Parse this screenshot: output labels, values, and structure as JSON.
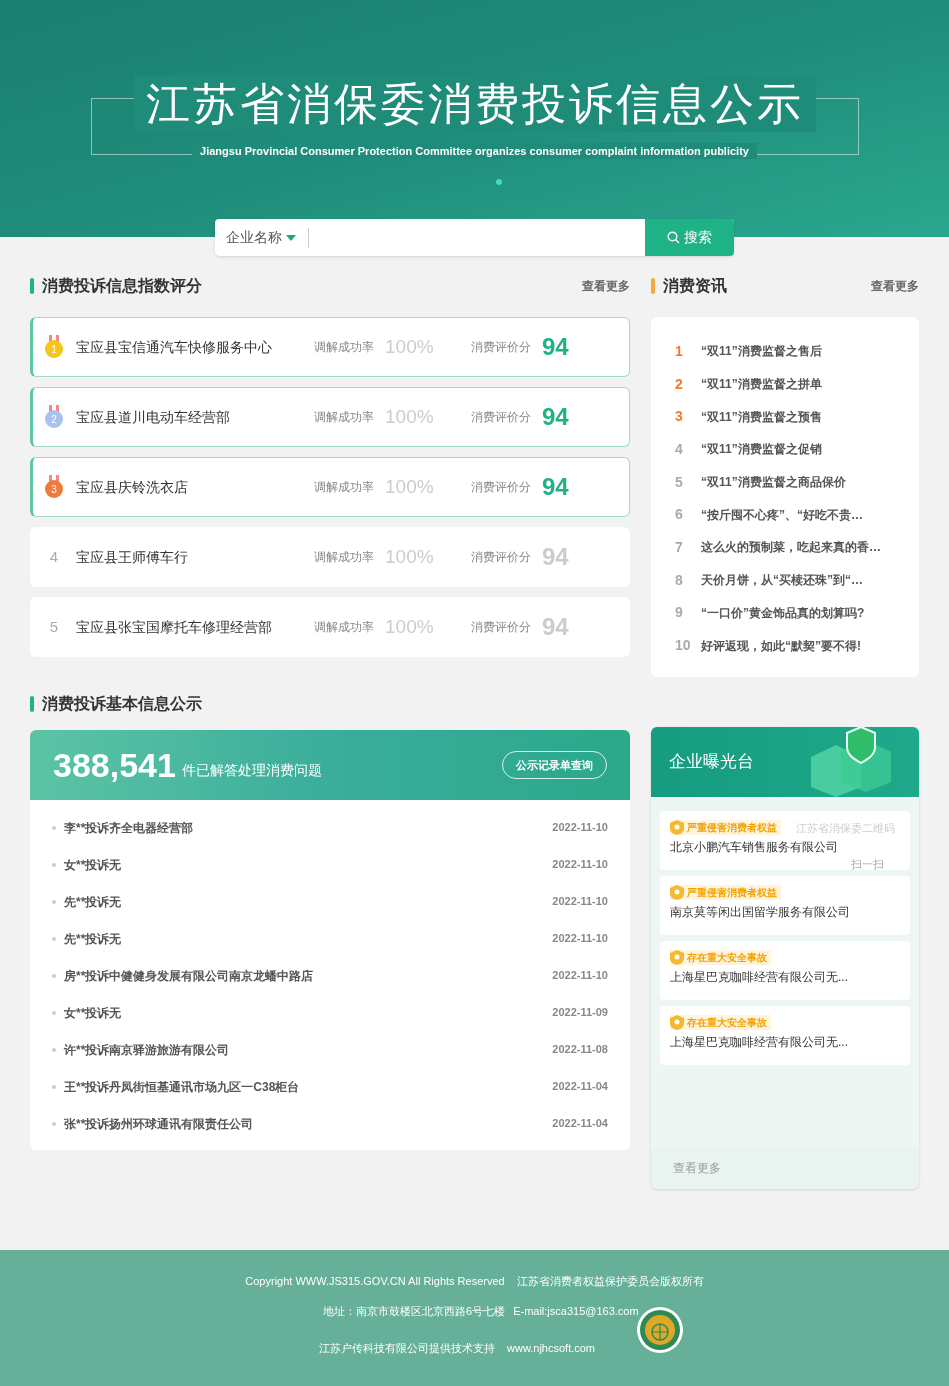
{
  "banner": {
    "title": "江苏省消保委消费投诉信息公示",
    "subtitle": "Jiangsu Provincial Consumer Protection Committee organizes consumer complaint information publicity"
  },
  "search": {
    "category": "企业名称",
    "button": "搜索"
  },
  "ranking": {
    "title": "消费投诉信息指数评分",
    "more": "查看更多",
    "rows": [
      {
        "rank": "1",
        "highlighted": true,
        "color": "#f5c518",
        "name": "宝应县宝信通汽车快修服务中心",
        "rate_label": "调解成功率",
        "rate": "100%",
        "score_label": "消费评价分",
        "score": "94"
      },
      {
        "rank": "2",
        "highlighted": true,
        "color": "#a9c1ee",
        "name": "宝应县道川电动车经营部",
        "rate_label": "调解成功率",
        "rate": "100%",
        "score_label": "消费评价分",
        "score": "94"
      },
      {
        "rank": "3",
        "highlighted": true,
        "color": "#ee7a3c",
        "name": "宝应县庆铃洗衣店",
        "rate_label": "调解成功率",
        "rate": "100%",
        "score_label": "消费评价分",
        "score": "94"
      },
      {
        "rank": "4",
        "highlighted": false,
        "name": "宝应县王师傅车行",
        "rate_label": "调解成功率",
        "rate": "100%",
        "score_label": "消费评价分",
        "score": "94"
      },
      {
        "rank": "5",
        "highlighted": false,
        "name": "宝应县张宝国摩托车修理经营部",
        "rate_label": "调解成功率",
        "rate": "100%",
        "score_label": "消费评价分",
        "score": "94"
      }
    ]
  },
  "news": {
    "title": "消费资讯",
    "more": "查看更多",
    "items": [
      {
        "number": "1",
        "highlighted": true,
        "title": "“双11”消费监督之售后"
      },
      {
        "number": "2",
        "highlighted": true,
        "title": "“双11”消费监督之拼单"
      },
      {
        "number": "3",
        "highlighted": true,
        "title": "“双11”消费监督之预售"
      },
      {
        "number": "4",
        "highlighted": false,
        "title": "“双11”消费监督之促销"
      },
      {
        "number": "5",
        "highlighted": false,
        "title": "“双11”消费监督之商品保价"
      },
      {
        "number": "6",
        "highlighted": false,
        "title": "“按斤囤不心疼”、“好吃不贵…"
      },
      {
        "number": "7",
        "highlighted": false,
        "title": "这么火的预制菜，吃起来真的香…"
      },
      {
        "number": "8",
        "highlighted": false,
        "title": "天价月饼，从“买椟还珠”到“…"
      },
      {
        "number": "9",
        "highlighted": false,
        "title": "“一口价”黄金饰品真的划算吗?"
      },
      {
        "number": "10",
        "highlighted": false,
        "title": "好评返现，如此“默契”要不得!"
      }
    ]
  },
  "complaints": {
    "title": "消费投诉基本信息公示",
    "count": "388,541",
    "count_label": "件已解答处理消费问题",
    "query_button": "公示记录单查询",
    "rows": [
      {
        "text": "李**投诉齐全电器经营部",
        "date": "2022-11-10"
      },
      {
        "text": "女**投诉无",
        "date": "2022-11-10"
      },
      {
        "text": "先**投诉无",
        "date": "2022-11-10"
      },
      {
        "text": "先**投诉无",
        "date": "2022-11-10"
      },
      {
        "text": "房**投诉中健健身发展有限公司南京龙蟠中路店",
        "date": "2022-11-10"
      },
      {
        "text": "女**投诉无",
        "date": "2022-11-09"
      },
      {
        "text": "许**投诉南京驿游旅游有限公司",
        "date": "2022-11-08"
      },
      {
        "text": "王**投诉丹凤街恒基通讯市场九区一C38柜台",
        "date": "2022-11-04"
      },
      {
        "text": "张**投诉扬州环球通讯有限责任公司",
        "date": "2022-11-04"
      }
    ]
  },
  "exposure": {
    "title": "企业曝光台",
    "more": "查看更多",
    "items": [
      {
        "tag": "严重侵害消费者权益",
        "company": "北京小鹏汽车销售服务有限公司"
      },
      {
        "tag": "严重侵害消费者权益",
        "company": "南京莫等闲出国留学服务有限公司"
      },
      {
        "tag": "存在重大安全事故",
        "company": "上海星巴克咖啡经营有限公司无..."
      },
      {
        "tag": "存在重大安全事故",
        "company": "上海星巴克咖啡经营有限公司无..."
      }
    ],
    "qr_popup": {
      "caption": "江苏省消保委二维码",
      "hint": "扫一扫"
    }
  },
  "footer": {
    "copyright": "Copyright WWW.JS315.GOV.CN All Rights Reserved",
    "owner": "江苏省消费者权益保护委员会版权所有",
    "address": "地址：南京市鼓楼区北京西路6号七楼",
    "email": "E-mail:jsca315@163.com",
    "support": "江苏户传科技有限公司提供技术支持",
    "website": "www.njhcsoft.com"
  }
}
